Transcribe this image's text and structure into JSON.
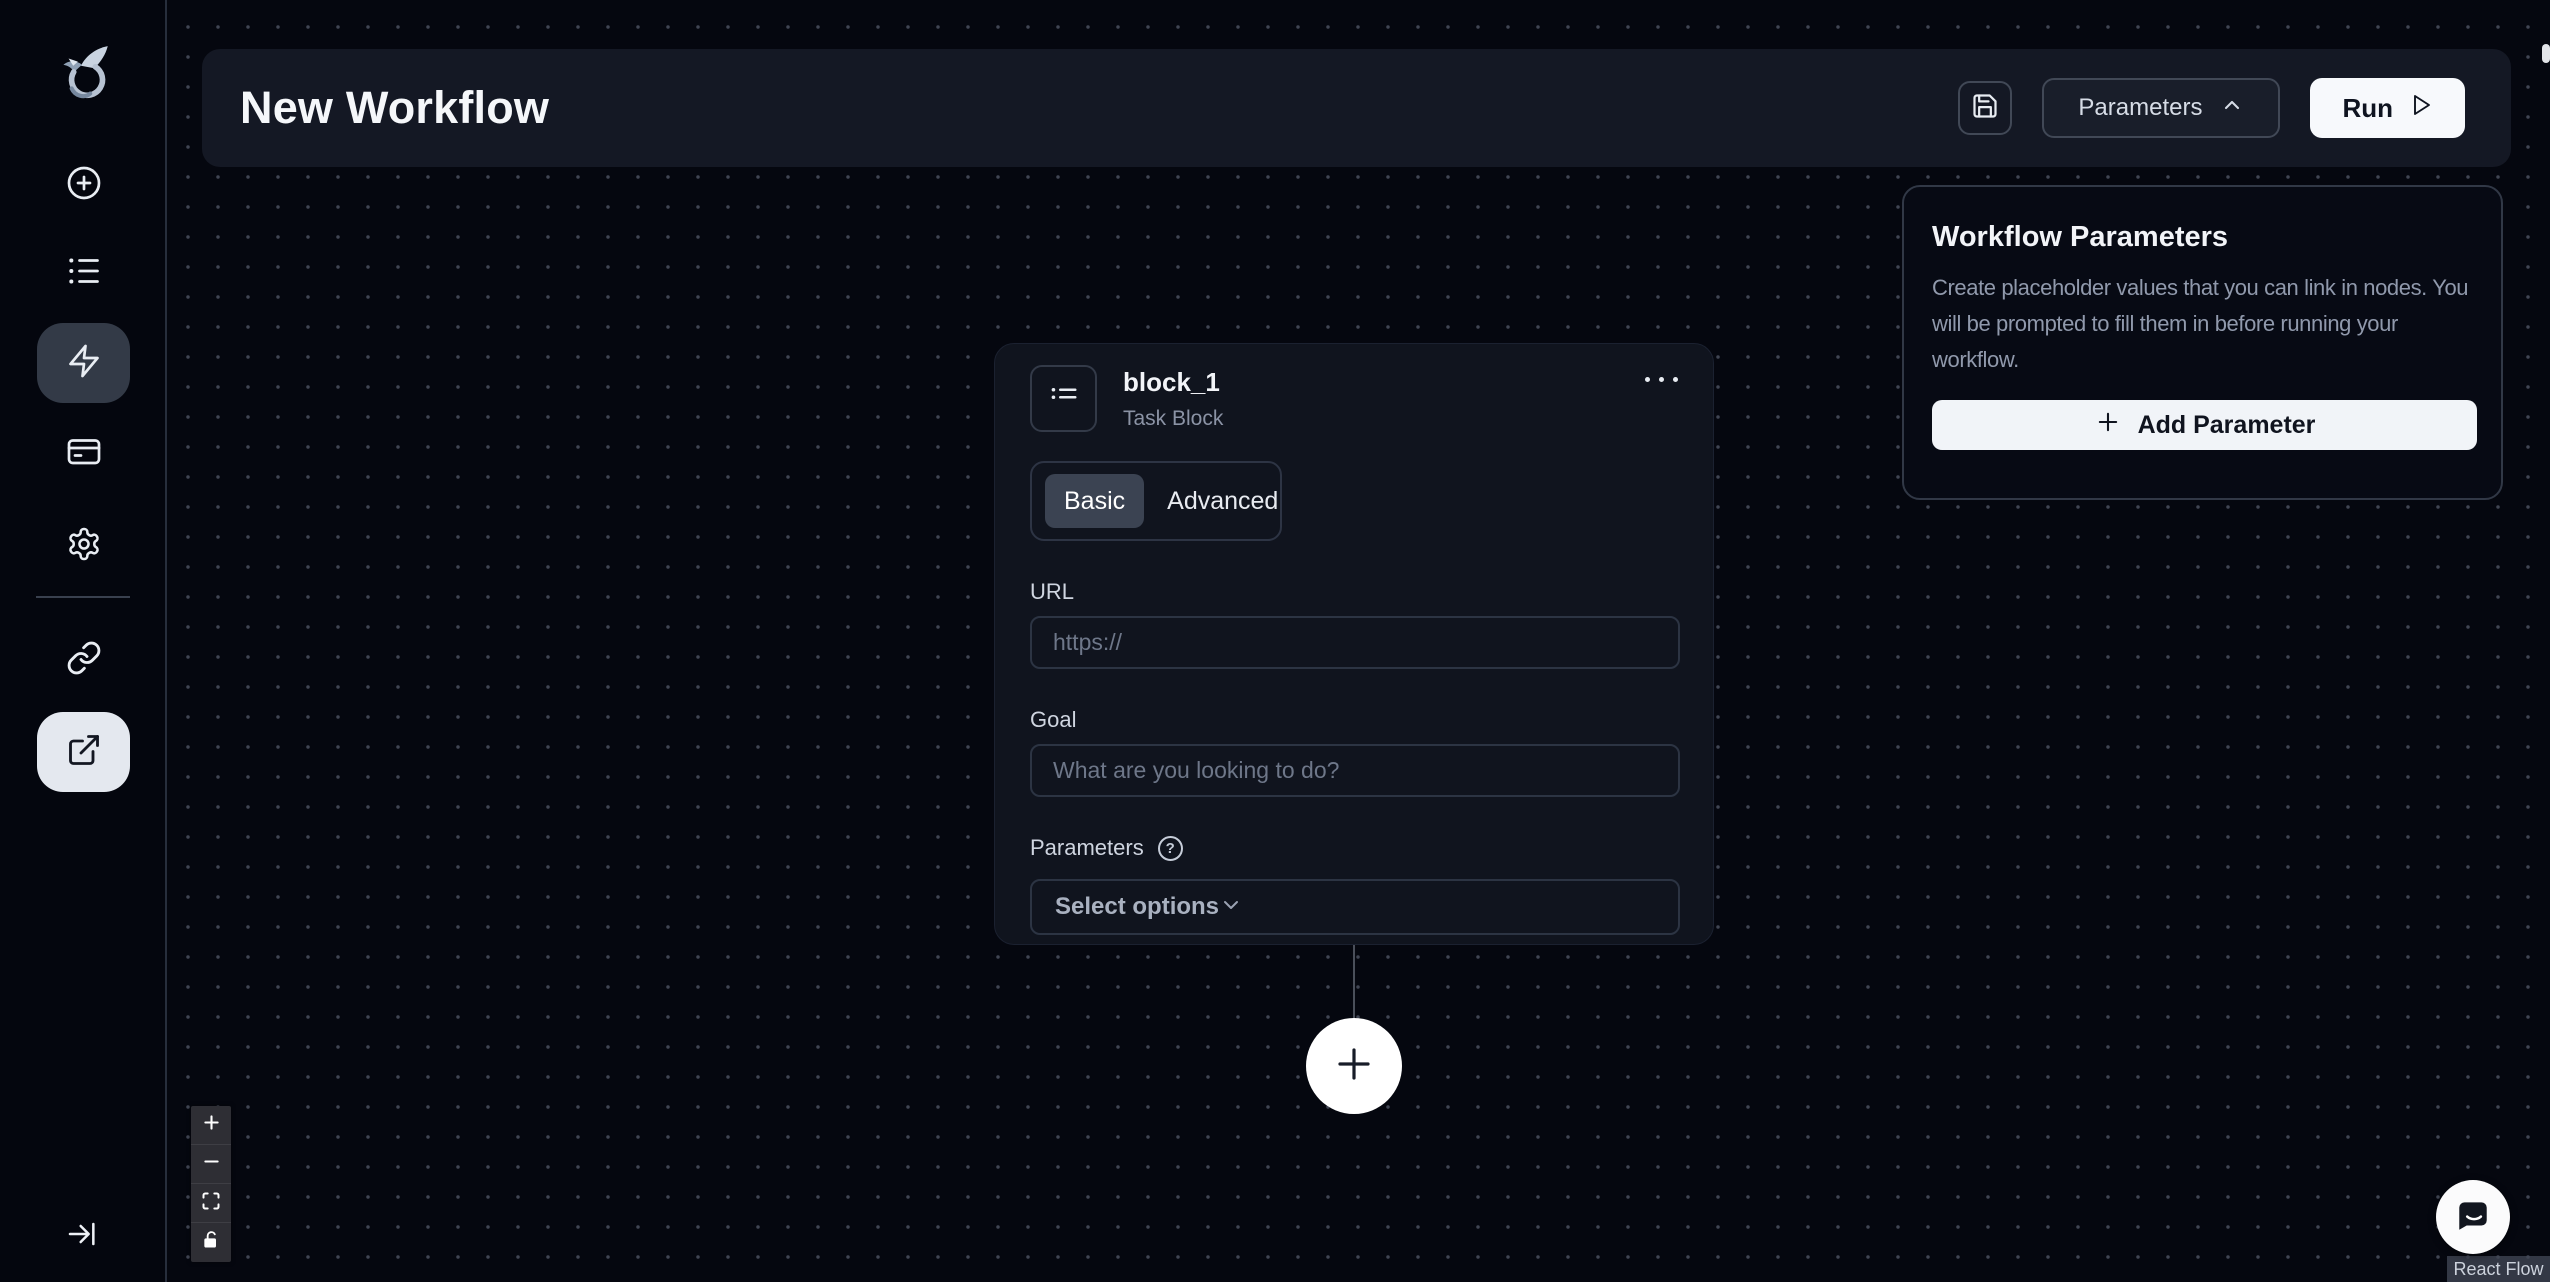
{
  "header": {
    "title": "New Workflow",
    "parameters_button_label": "Parameters",
    "run_button_label": "Run"
  },
  "sidebar": {
    "icons": [
      "plus-circle",
      "list",
      "zap",
      "credit-card",
      "settings",
      "link",
      "external-link"
    ],
    "selected_icon": "external-link",
    "highlighted_icon": "zap",
    "collapse_icon": "arrow-right-to-line"
  },
  "workflow_parameters_panel": {
    "title": "Workflow Parameters",
    "description": "Create placeholder values that you can link in nodes. You will be prompted to fill them in before running your workflow.",
    "add_parameter_label": "Add Parameter"
  },
  "task_block": {
    "title": "block_1",
    "subtitle": "Task Block",
    "more_options_icon": "ellipsis",
    "tabs": [
      {
        "label": "Basic",
        "active": true
      },
      {
        "label": "Advanced",
        "active": false
      }
    ],
    "url": {
      "label": "URL",
      "placeholder": "https://",
      "value": ""
    },
    "goal": {
      "label": "What are you looking to do?",
      "value": "",
      "field_label": "Goal",
      "placeholder": "What are you looking to do?"
    },
    "parameters": {
      "label": "Parameters",
      "select_placeholder": "Select options"
    }
  },
  "canvas": {
    "zoom_controls": [
      "zoom-in",
      "zoom-out",
      "fit-view",
      "lock"
    ],
    "attribution": "React Flow"
  },
  "colors": {
    "canvas_bg": "#05070f",
    "header_bg": "#141824",
    "card_bg": "#10141e",
    "accent_light": "#f1f4f8",
    "border": "#2c3443",
    "selected_tab_bg": "#3b4352",
    "selected_nav_bg": "#333a47",
    "muted_text": "#8b93a5"
  }
}
